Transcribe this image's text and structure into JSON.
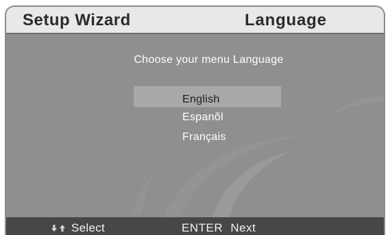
{
  "header": {
    "title": "Setup Wizard",
    "section": "Language"
  },
  "main": {
    "prompt": "Choose your menu Language",
    "languages": [
      {
        "label": "English",
        "selected": true
      },
      {
        "label": "Espanõl",
        "selected": false
      },
      {
        "label": "Français",
        "selected": false
      }
    ]
  },
  "footer": {
    "nav_icons": [
      "down-arrow-icon",
      "up-arrow-icon"
    ],
    "select_label": "Select",
    "enter_key": "ENTER",
    "enter_label": "Next"
  },
  "colors": {
    "panel_bg": "#8f8f8f",
    "header_bg": "#e8e8e8",
    "highlight_bg": "#a8a8a8",
    "footer_bg": "#474747",
    "text": "#ffffff"
  }
}
